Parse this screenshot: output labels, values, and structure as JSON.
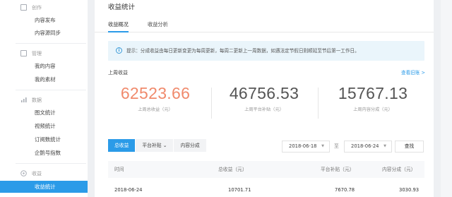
{
  "sidebar": {
    "groups": [
      {
        "label": "创作",
        "icon": "edit-icon",
        "items": [
          {
            "label": "内容发布"
          },
          {
            "label": "内容源同步"
          }
        ]
      },
      {
        "label": "管理",
        "icon": "folder-icon",
        "items": [
          {
            "label": "我的内容"
          },
          {
            "label": "我的素材"
          }
        ]
      },
      {
        "label": "数据",
        "icon": "chart-icon",
        "items": [
          {
            "label": "图文统计"
          },
          {
            "label": "视频统计"
          },
          {
            "label": "订阅数统计"
          },
          {
            "label": "企鹅号指数"
          }
        ]
      },
      {
        "label": "收益",
        "icon": "coin-icon",
        "items": [
          {
            "label": "收益统计",
            "active": true
          }
        ]
      }
    ]
  },
  "main": {
    "title": "收益统计",
    "tabs": [
      {
        "label": "收益概况",
        "active": true
      },
      {
        "label": "收益分析"
      }
    ],
    "notice": "提示：分成收益由每日更新变更为每周更新，每周二更新上一周数据，如遇法定节假日则顺延至节后第一工作日。",
    "section_label": "上周收益",
    "view_history": "查看旧账 >",
    "stats": [
      {
        "value": "62523.66",
        "label": "上周总收益（元）",
        "color": "#f08a6c"
      },
      {
        "value": "46756.53",
        "label": "上周平台补贴（元）",
        "color": "#555555"
      },
      {
        "value": "15767.13",
        "label": "上周内容分成（元）",
        "color": "#555555"
      }
    ],
    "segment_tabs": [
      {
        "label": "总收益",
        "active": true
      },
      {
        "label": "平台补贴 ⌄"
      },
      {
        "label": "内容分成"
      }
    ],
    "date_from": "2018-06-18",
    "date_to": "2018-06-24",
    "to_label": "至",
    "query_label": "查找",
    "table": {
      "headers": [
        "时间",
        "总收益（元）",
        "平台补贴（元）",
        "内容分成（元）"
      ],
      "rows": [
        [
          "2018-06-24",
          "10701.71",
          "7670.78",
          "3030.93"
        ]
      ]
    }
  },
  "colors": {
    "accent": "#2b9be8",
    "highlight_value": "#f08a6c",
    "notice_bg": "#eaf5fb"
  }
}
